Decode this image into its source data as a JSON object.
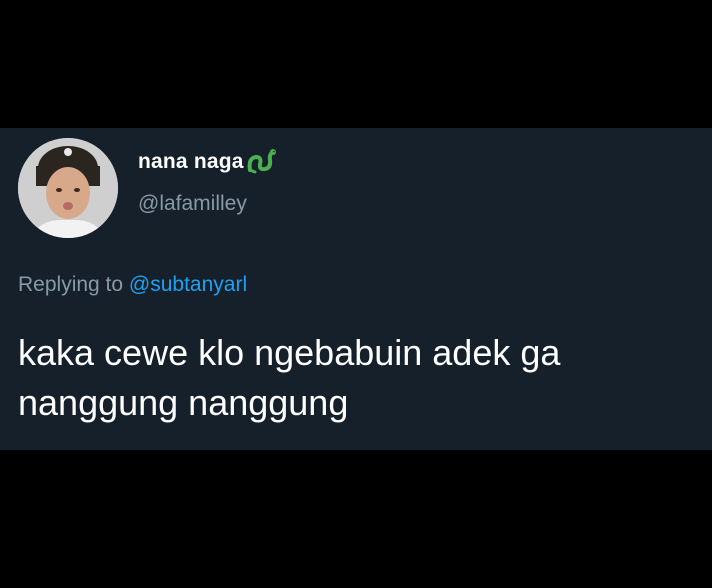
{
  "tweet": {
    "author": {
      "display_name": "nana naga",
      "name_emoji": "snake-icon",
      "handle": "@lafamilley"
    },
    "reply": {
      "prefix": "Replying to ",
      "mention": "@subtanyarl"
    },
    "text": {
      "line1": "kaka cewe klo ngebabuin adek ga",
      "line2": "nanggung nanggung"
    }
  },
  "colors": {
    "page_background": "#000000",
    "card_background": "#15202b",
    "primary_text": "#ffffff",
    "secondary_text": "#8899a6",
    "mention": "#1da1f2",
    "snake_green": "#4caf50"
  }
}
